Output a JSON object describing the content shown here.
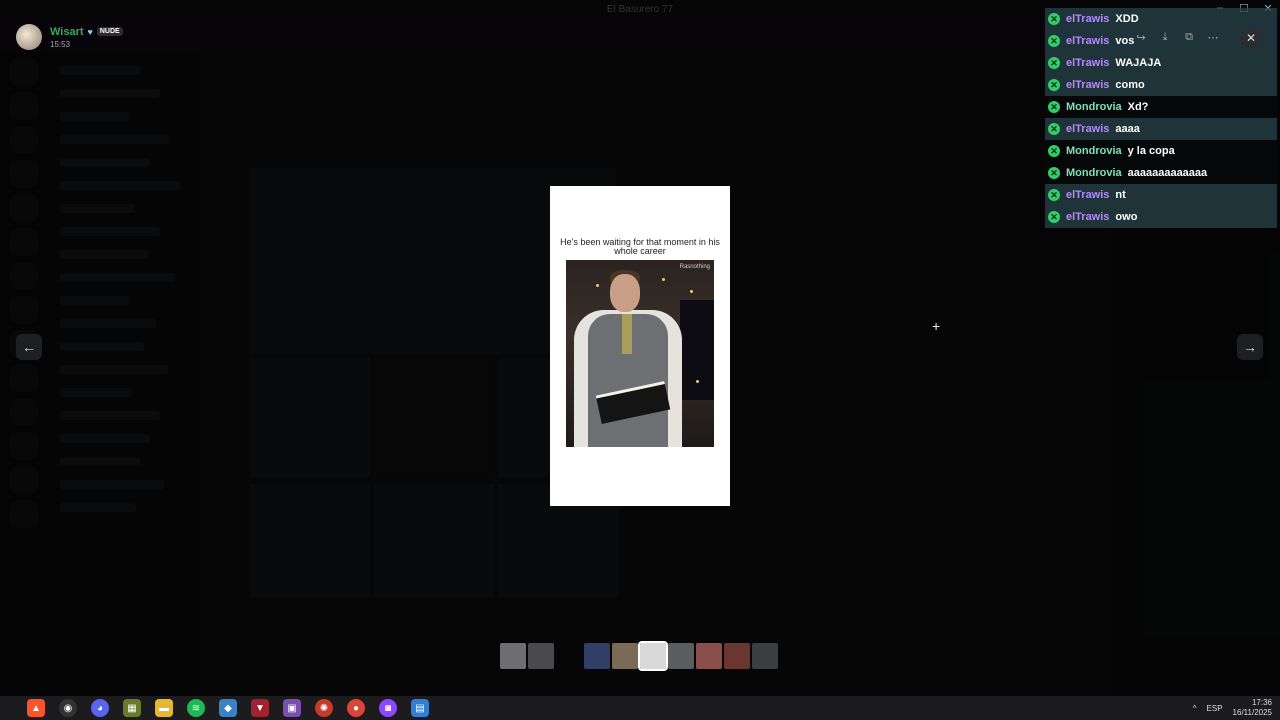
{
  "window": {
    "title": "El Basurero 77"
  },
  "uploader": {
    "name": "Wisart",
    "badge": "NUDE",
    "time": "15:53"
  },
  "media": {
    "caption": "He's been waiting for that moment in his whole career",
    "watermark": "Rasnothing"
  },
  "nav": {
    "prev": "←",
    "next": "→"
  },
  "chat": [
    {
      "user": "elTrawis",
      "message": "XDD",
      "style": "alt"
    },
    {
      "user": "elTrawis",
      "message": "vos",
      "style": "alt"
    },
    {
      "user": "elTrawis",
      "message": "WAJAJA",
      "style": "alt"
    },
    {
      "user": "elTrawis",
      "message": "como",
      "style": "alt"
    },
    {
      "user": "Mondrovia",
      "message": "Xd?",
      "style": "plain"
    },
    {
      "user": "elTrawis",
      "message": "aaaa",
      "style": "alt"
    },
    {
      "user": "Mondrovia",
      "message": "y la copa",
      "style": "plain"
    },
    {
      "user": "Mondrovia",
      "message": "aaaaaaaaaaaaa",
      "style": "plain"
    },
    {
      "user": "elTrawis",
      "message": "nt",
      "style": "alt"
    },
    {
      "user": "elTrawis",
      "message": "owo",
      "style": "alt"
    }
  ],
  "toolbar": {
    "icons": [
      "forward-icon",
      "download-icon",
      "open-external-icon",
      "more-icon"
    ]
  },
  "taskbar": {
    "language": "ESP",
    "time": "17:36",
    "date": "16/11/2025",
    "apps": [
      "brave",
      "obs",
      "discord",
      "game",
      "file-explorer",
      "spotify",
      "app",
      "teams",
      "app2",
      "app3",
      "chrome",
      "twitch",
      "notepad"
    ]
  }
}
